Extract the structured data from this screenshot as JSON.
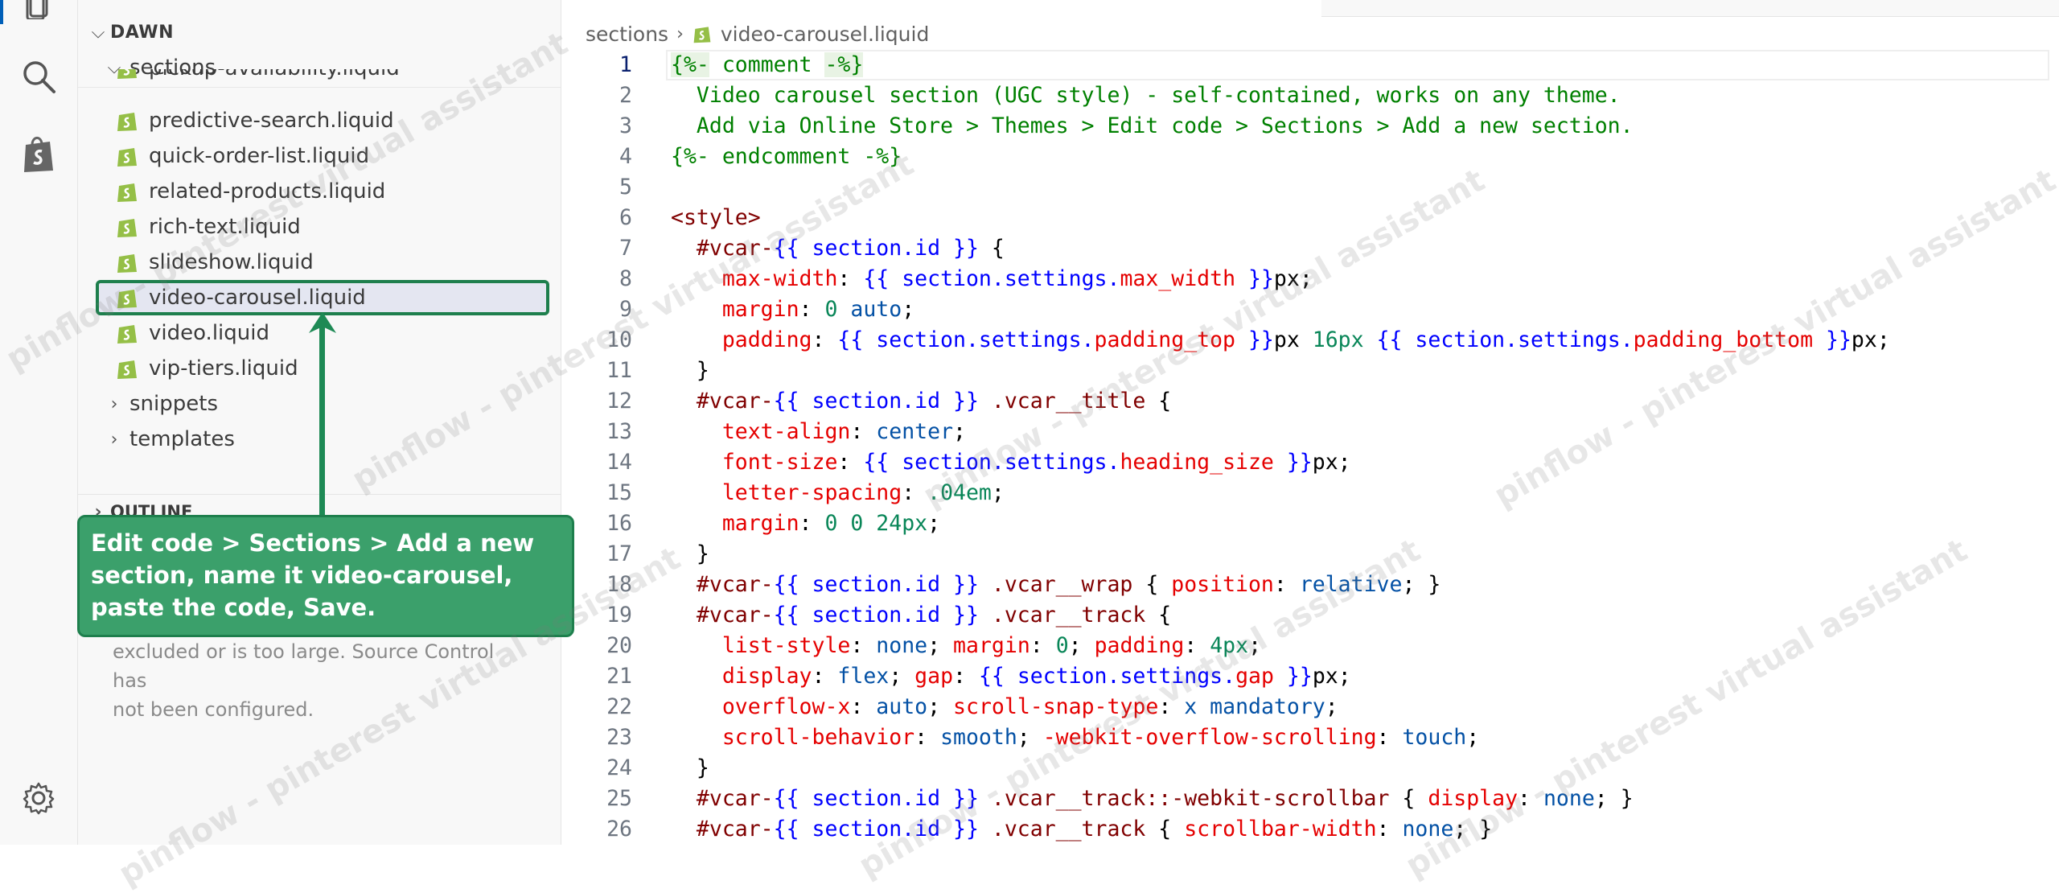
{
  "sidebar": {
    "root": "DAWN",
    "folder_sections": "sections",
    "files": [
      "pickup-availability.liquid",
      "predictive-search.liquid",
      "quick-order-list.liquid",
      "related-products.liquid",
      "rich-text.liquid",
      "slideshow.liquid",
      "video-carousel.liquid",
      "video.liquid",
      "vip-tiers.liquid"
    ],
    "folder_snippets": "snippets",
    "folder_templates": "templates",
    "outline": "OUTLINE",
    "source_control_note_1": "excluded or is too large. Source Control has",
    "source_control_note_2": "not been configured."
  },
  "callout": {
    "line1": "Edit code > Sections > Add a new",
    "line2": "section, name it video-carousel,",
    "line3": "paste the code, Save."
  },
  "editor": {
    "breadcrumb_folder": "sections",
    "breadcrumb_file": "video-carousel.liquid",
    "active_line": 1
  },
  "code_lines": [
    [
      [
        "liq",
        "{%-"
      ],
      [
        "cmt",
        " comment "
      ],
      [
        "liq",
        "-%}"
      ]
    ],
    [
      [
        "cmt",
        "  Video carousel section (UGC style) - self-contained, works on any theme."
      ]
    ],
    [
      [
        "cmt",
        "  Add via Online Store > Themes > Edit code > Sections > Add a new section."
      ]
    ],
    [
      [
        "cmt",
        "{%- endcomment -%}"
      ]
    ],
    [],
    [
      [
        "tag",
        "<style>"
      ]
    ],
    [
      [
        "sel",
        "  #vcar-"
      ],
      [
        "var",
        "{{ section.id }}"
      ],
      [
        "pun",
        " {"
      ]
    ],
    [
      [
        "prop",
        "    max-width"
      ],
      [
        "pun",
        ": "
      ],
      [
        "var",
        "{{ section.settings."
      ],
      [
        "prop",
        "max_width"
      ],
      [
        "var",
        " }}"
      ],
      [
        "pun",
        "px;"
      ]
    ],
    [
      [
        "prop",
        "    margin"
      ],
      [
        "pun",
        ": "
      ],
      [
        "num",
        "0"
      ],
      [
        "val",
        " auto"
      ],
      [
        "pun",
        ";"
      ]
    ],
    [
      [
        "prop",
        "    padding"
      ],
      [
        "pun",
        ": "
      ],
      [
        "var",
        "{{ section.settings."
      ],
      [
        "prop",
        "padding_top"
      ],
      [
        "var",
        " }}"
      ],
      [
        "pun",
        "px "
      ],
      [
        "num",
        "16px"
      ],
      [
        "pun",
        " "
      ],
      [
        "var",
        "{{ section.settings."
      ],
      [
        "prop",
        "padding_bottom"
      ],
      [
        "var",
        " }}"
      ],
      [
        "pun",
        "px;"
      ]
    ],
    [
      [
        "pun",
        "  }"
      ]
    ],
    [
      [
        "sel",
        "  #vcar-"
      ],
      [
        "var",
        "{{ section.id }}"
      ],
      [
        "sel",
        " .vcar__title"
      ],
      [
        "pun",
        " {"
      ]
    ],
    [
      [
        "prop",
        "    text-align"
      ],
      [
        "pun",
        ": "
      ],
      [
        "val",
        "center"
      ],
      [
        "pun",
        ";"
      ]
    ],
    [
      [
        "prop",
        "    font-size"
      ],
      [
        "pun",
        ": "
      ],
      [
        "var",
        "{{ section.settings."
      ],
      [
        "prop",
        "heading_size"
      ],
      [
        "var",
        " }}"
      ],
      [
        "pun",
        "px;"
      ]
    ],
    [
      [
        "prop",
        "    letter-spacing"
      ],
      [
        "pun",
        ": "
      ],
      [
        "num",
        ".04em"
      ],
      [
        "pun",
        ";"
      ]
    ],
    [
      [
        "prop",
        "    margin"
      ],
      [
        "pun",
        ": "
      ],
      [
        "num",
        "0 0 24px"
      ],
      [
        "pun",
        ";"
      ]
    ],
    [
      [
        "pun",
        "  }"
      ]
    ],
    [
      [
        "sel",
        "  #vcar-"
      ],
      [
        "var",
        "{{ section.id }}"
      ],
      [
        "sel",
        " .vcar__wrap"
      ],
      [
        "pun",
        " { "
      ],
      [
        "prop",
        "position"
      ],
      [
        "pun",
        ": "
      ],
      [
        "val",
        "relative"
      ],
      [
        "pun",
        "; }"
      ]
    ],
    [
      [
        "sel",
        "  #vcar-"
      ],
      [
        "var",
        "{{ section.id }}"
      ],
      [
        "sel",
        " .vcar__track"
      ],
      [
        "pun",
        " {"
      ]
    ],
    [
      [
        "prop",
        "    list-style"
      ],
      [
        "pun",
        ": "
      ],
      [
        "val",
        "none"
      ],
      [
        "pun",
        "; "
      ],
      [
        "prop",
        "margin"
      ],
      [
        "pun",
        ": "
      ],
      [
        "num",
        "0"
      ],
      [
        "pun",
        "; "
      ],
      [
        "prop",
        "padding"
      ],
      [
        "pun",
        ": "
      ],
      [
        "num",
        "4px"
      ],
      [
        "pun",
        ";"
      ]
    ],
    [
      [
        "prop",
        "    display"
      ],
      [
        "pun",
        ": "
      ],
      [
        "val",
        "flex"
      ],
      [
        "pun",
        "; "
      ],
      [
        "prop",
        "gap"
      ],
      [
        "pun",
        ": "
      ],
      [
        "var",
        "{{ section.settings."
      ],
      [
        "prop",
        "gap"
      ],
      [
        "var",
        " }}"
      ],
      [
        "pun",
        "px;"
      ]
    ],
    [
      [
        "prop",
        "    overflow-x"
      ],
      [
        "pun",
        ": "
      ],
      [
        "val",
        "auto"
      ],
      [
        "pun",
        "; "
      ],
      [
        "prop",
        "scroll-snap-type"
      ],
      [
        "pun",
        ": "
      ],
      [
        "val",
        "x mandatory"
      ],
      [
        "pun",
        ";"
      ]
    ],
    [
      [
        "prop",
        "    scroll-behavior"
      ],
      [
        "pun",
        ": "
      ],
      [
        "val",
        "smooth"
      ],
      [
        "pun",
        "; "
      ],
      [
        "prop",
        "-webkit-overflow-scrolling"
      ],
      [
        "pun",
        ": "
      ],
      [
        "val",
        "touch"
      ],
      [
        "pun",
        ";"
      ]
    ],
    [
      [
        "pun",
        "  }"
      ]
    ],
    [
      [
        "sel",
        "  #vcar-"
      ],
      [
        "var",
        "{{ section.id }}"
      ],
      [
        "sel",
        " .vcar__track::-webkit-scrollbar"
      ],
      [
        "pun",
        " { "
      ],
      [
        "prop",
        "display"
      ],
      [
        "pun",
        ": "
      ],
      [
        "val",
        "none"
      ],
      [
        "pun",
        "; }"
      ]
    ],
    [
      [
        "sel",
        "  #vcar-"
      ],
      [
        "var",
        "{{ section.id }}"
      ],
      [
        "sel",
        " .vcar__track"
      ],
      [
        "pun",
        " { "
      ],
      [
        "prop",
        "scrollbar-width"
      ],
      [
        "pun",
        ": "
      ],
      [
        "val",
        "none"
      ],
      [
        "pun",
        "; }"
      ]
    ]
  ],
  "watermark_text": "pinflow - pinterest virtual assistant",
  "colors": {
    "highlight_border": "#1e7f4d",
    "callout_bg": "#3ba06b",
    "shopify_green": "#95bf47"
  },
  "icons": [
    "explorer-icon",
    "search-icon",
    "shopify-bag-icon",
    "settings-gear-icon",
    "shopify-file-icon",
    "chevron-down-icon",
    "chevron-right-icon"
  ]
}
